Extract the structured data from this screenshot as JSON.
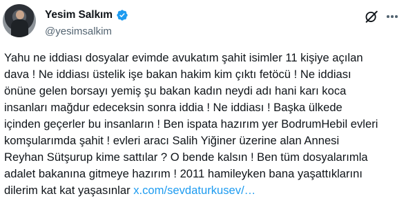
{
  "author": {
    "display_name": "Yesim Salkım",
    "handle": "@yesimsalkim",
    "verified": true,
    "avatar_icon": "user-avatar",
    "verified_color": "#1d9bf0"
  },
  "actions": {
    "grok_icon": "grok-icon",
    "more_icon": "more-dots-icon"
  },
  "tweet": {
    "lines": [
      "Yahu ne iddiası dosyalar evimde avukatım şahit isimler 11 kişiye açılan",
      "dava ! Ne iddiası üstelik işe bakan hakim kim çıktı fetöcü ! Ne iddiası",
      "önüne gelen borsayı yemiş şu bakan kadın neydi adı hani  karı koca",
      "insanları  mağdur edeceksin sonra iddia ! Ne iddiası ! Başka ülkede",
      "içinden geçerler bu insanların ! Ben ispata hazırım yer BodrumHebil evleri",
      "komşularımda şahit ! evleri aracı Salih Yiğiner üzerine alan Annesi",
      "Reyhan Sütşurup kime sattılar ? O bende kalsın ! Ben tüm dosyalarımla",
      "adalet bakanına gitmeye hazırım ! 2011 hamileyken bana yaşattıklarını"
    ],
    "last_line_text": "dilerim kat kat yaşasınlar ",
    "link_text": "x.com/sevdaturkusev/…"
  }
}
